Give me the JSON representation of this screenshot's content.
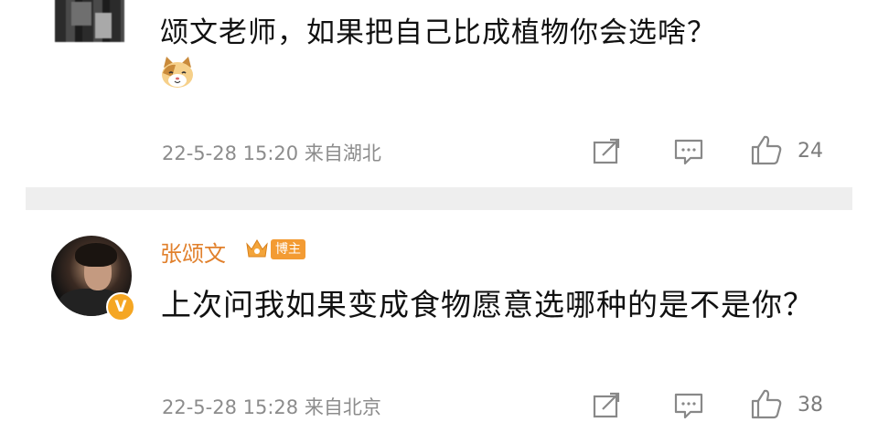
{
  "post1": {
    "text": "颂文老师，如果把自己比成植物你会选啥？",
    "meta": "22-5-28 15:20 来自湖北",
    "likes": "24",
    "emoji": "cat-emoji"
  },
  "post2": {
    "username": "张颂文",
    "badge": "博主",
    "verified_mark": "V",
    "text": "上次问我如果变成食物愿意选哪种的是不是你？",
    "meta": "22-5-28 15:28 来自北京",
    "likes": "38"
  },
  "icons": {
    "share": "share-icon",
    "comment": "comment-icon",
    "like": "thumbs-up-icon"
  },
  "colors": {
    "username": "#e1802c",
    "meta": "#8c8c8c",
    "divider": "#eeeeee",
    "badge": "#f39b33"
  }
}
